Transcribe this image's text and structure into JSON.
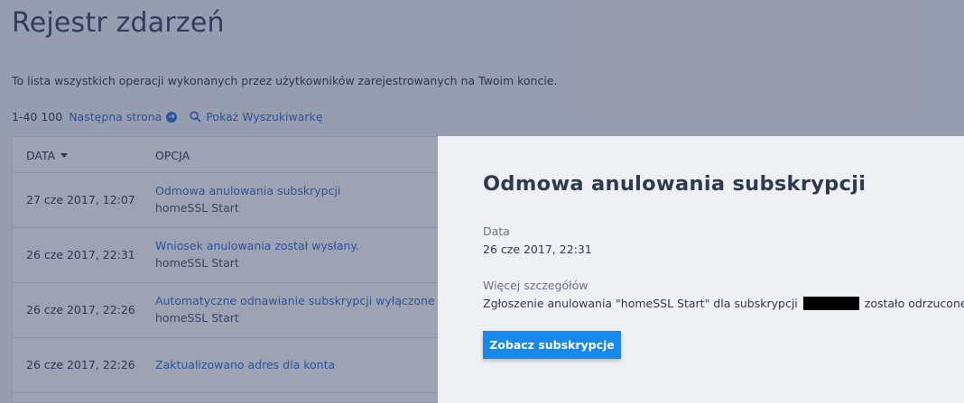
{
  "page": {
    "title": "Rejestr zdarzeń",
    "description": "To lista wszystkich operacji wykonanych przez użytkowników zarejestrowanych na Twoim koncie.",
    "pager": {
      "range": "1-40 100",
      "next_label": "Następna strona",
      "search_label": "Pokaż Wyszukiwarkę"
    }
  },
  "table": {
    "headers": {
      "date": "DATA",
      "option": "OPCJA"
    },
    "rows": [
      {
        "date": "27 cze 2017, 12:07",
        "option": "Odmowa anulowania subskrypcji",
        "detail": "homeSSL Start"
      },
      {
        "date": "26 cze 2017, 22:31",
        "option": "Wniosek anulowania został wysłany.",
        "detail": "homeSSL Start"
      },
      {
        "date": "26 cze 2017, 22:26",
        "option": "Automatyczne odnawianie subskrypcji wyłączone",
        "detail": "homeSSL Start"
      },
      {
        "date": "26 cze 2017, 22:26",
        "option": "Zaktualizowano adres dla konta",
        "detail": ""
      }
    ]
  },
  "panel": {
    "title": "Odmowa anulowania subskrypcji",
    "date_label": "Data",
    "date_value": "26 cze 2017, 22:31",
    "details_label": "Więcej szczegółów",
    "details_before": "Zgłoszenie anulowania \"homeSSL Start\" dla subskrypcji",
    "details_after": "zostało odrzucone",
    "button_label": "Zobacz subskrypcje"
  },
  "colors": {
    "accent": "#1589ee",
    "link": "#2f6fd1",
    "overlay": "rgba(40,52,88,0.45)"
  }
}
